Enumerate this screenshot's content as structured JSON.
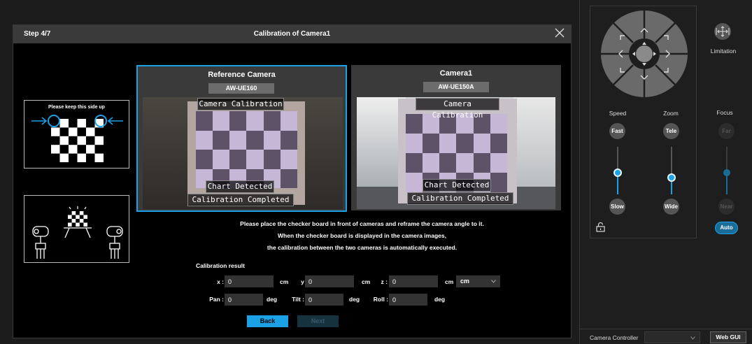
{
  "dialog": {
    "step": "Step 4/7",
    "title": "Calibration of Camera1"
  },
  "guides": {
    "orientation_note": "Please keep this side up"
  },
  "reference_camera": {
    "title": "Reference Camera",
    "model": "AW-UE160",
    "overlay_top": "Camera Calibration",
    "overlay_mid": "Chart Detected",
    "overlay_bottom": "Calibration Completed"
  },
  "target_camera": {
    "title": "Camera1",
    "model": "AW-UE150A",
    "overlay_top": "Camera Calibration",
    "overlay_mid": "Chart Detected",
    "overlay_bottom": "Calibration Completed"
  },
  "instructions": [
    "Please place the checker board in front of cameras and reframe the camera angle to it.",
    "When the checker board is displayed in the camera images,",
    "the calibration between the two cameras is automatically executed."
  ],
  "calibration": {
    "label": "Calibration result",
    "x_label": "x :",
    "x_value": "0",
    "x_unit": "cm",
    "y_label": "y :",
    "y_value": "0",
    "y_unit": "cm",
    "z_label": "z :",
    "z_value": "0",
    "z_unit": "cm",
    "unit_select": "cm",
    "pan_label": "Pan :",
    "pan_value": "0",
    "pan_unit": "deg",
    "tilt_label": "Tilt :",
    "tilt_value": "0",
    "tilt_unit": "deg",
    "roll_label": "Roll :",
    "roll_value": "0",
    "roll_unit": "deg"
  },
  "buttons": {
    "back": "Back",
    "next": "Next"
  },
  "controller": {
    "limitation": "Limitation",
    "speed_label": "Speed",
    "zoom_label": "Zoom",
    "focus_label": "Focus",
    "fast": "Fast",
    "slow": "Slow",
    "tele": "Tele",
    "wide": "Wide",
    "far": "Far",
    "near": "Near",
    "auto": "Auto",
    "speed_level": 0.45,
    "zoom_level": 0.35,
    "focus_level": 0.45
  },
  "bottom": {
    "camera_controller": "Camera Controller",
    "web_gui": "Web GUI"
  },
  "colors": {
    "accent": "#1aa1e6",
    "dark_button": "#555555"
  }
}
